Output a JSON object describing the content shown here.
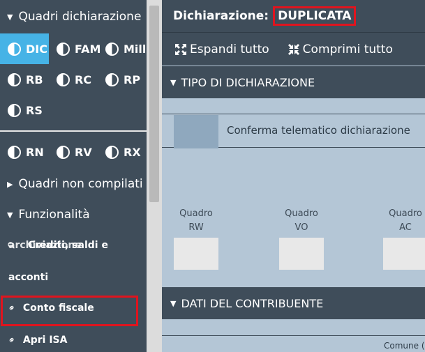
{
  "sidebar": {
    "section_quadri": "Quadri dichiarazione",
    "row1": [
      {
        "code": "DIC",
        "active": true
      },
      {
        "code": "FAM",
        "active": false
      },
      {
        "code": "Mille",
        "active": false
      }
    ],
    "row2": [
      {
        "code": "RB",
        "active": false
      },
      {
        "code": "RC",
        "active": false
      },
      {
        "code": "RP",
        "active": false
      }
    ],
    "row3": [
      {
        "code": "RS",
        "active": false
      }
    ],
    "row4": [
      {
        "code": "RN",
        "active": false
      },
      {
        "code": "RV",
        "active": false
      },
      {
        "code": "RX",
        "active": false
      }
    ],
    "section_non_compilati": "Quadri non compilati",
    "section_funzionalita": "Funzionalità",
    "func_items": {
      "crediti_line1": "Crediti, saldi e",
      "crediti_overlay": "archiviazione",
      "crediti_line2": "acconti",
      "conto_fiscale": "Conto fiscale",
      "apri_isa": "Apri ISA"
    }
  },
  "header": {
    "title": "Dichiarazione:",
    "status": "DUPLICATA"
  },
  "toolbar": {
    "expand_all": "Espandi tutto",
    "collapse_all": "Comprimi tutto"
  },
  "panels": {
    "tipo": {
      "title": "TIPO DI DICHIARAZIONE",
      "telematico_label": "Conferma telematico dichiarazione",
      "quadri": [
        {
          "line1": "Quadro",
          "line2": "RW"
        },
        {
          "line1": "Quadro",
          "line2": "VO"
        },
        {
          "line1": "Quadro",
          "line2": "AC"
        }
      ]
    },
    "contribuente": {
      "title": "DATI DEL CONTRIBUENTE",
      "comune_label": "Comune ("
    }
  },
  "colors": {
    "sidebar_bg": "#3f4d5a",
    "active_tab": "#46b3e6",
    "highlight_red": "#e0141e",
    "main_bg": "#b4c6d6"
  }
}
